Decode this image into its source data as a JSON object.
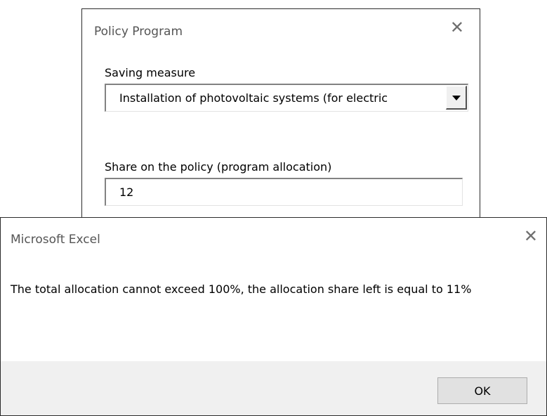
{
  "policy_window": {
    "title": "Policy Program",
    "close_glyph": "✕",
    "saving_measure_label": "Saving measure",
    "saving_measure_value": "Installation of photovoltaic systems (for electric",
    "share_label": "Share on the policy (program allocation)",
    "share_value": "12"
  },
  "message_box": {
    "title": "Microsoft Excel",
    "close_glyph": "✕",
    "message": "The total allocation cannot exceed 100%, the allocation share left is equal to 11%",
    "ok_label": "OK"
  },
  "icons": {
    "combo_arrow": "chevron-down-icon",
    "close": "close-icon"
  },
  "colors": {
    "title_text": "#555555",
    "footer_bg": "#f0f0f0",
    "button_bg": "#e1e1e1",
    "button_border": "#adadad"
  }
}
